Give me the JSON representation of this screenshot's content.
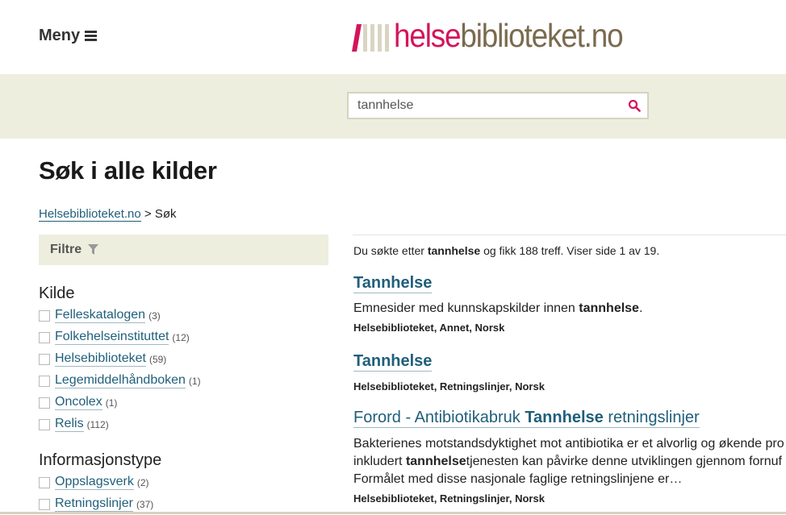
{
  "header": {
    "menu_label": "Meny",
    "logo_part1": "helse",
    "logo_part2": "biblioteket.no",
    "colors": {
      "pink": "#d4145a",
      "brown": "#7a6a4e",
      "beige": "#eeeedf",
      "link": "#1f5f7a"
    }
  },
  "search": {
    "value": "tannhelse",
    "icon": "search-icon"
  },
  "page": {
    "title": "Søk i alle kilder"
  },
  "breadcrumb": {
    "home": "Helsebiblioteket.no",
    "separator": ">",
    "current": "Søk"
  },
  "filters": {
    "label": "Filtre",
    "icon": "filter-icon",
    "groups": [
      {
        "title": "Kilde",
        "items": [
          {
            "label": "Felleskatalogen",
            "count": "(3)"
          },
          {
            "label": "Folkehelseinstituttet",
            "count": "(12)"
          },
          {
            "label": "Helsebiblioteket",
            "count": "(59)"
          },
          {
            "label": "Legemiddelhåndboken",
            "count": "(1)"
          },
          {
            "label": "Oncolex",
            "count": "(1)"
          },
          {
            "label": "Relis",
            "count": "(112)"
          }
        ]
      },
      {
        "title": "Informasjonstype",
        "items": [
          {
            "label": "Oppslagsverk",
            "count": "(2)"
          },
          {
            "label": "Retningslinjer",
            "count": "(37)"
          }
        ]
      }
    ]
  },
  "summary": {
    "prefix": "Du søkte etter",
    "term": "tannhelse",
    "suffix": "og fikk 188 treff. Viser side 1 av 19."
  },
  "results": [
    {
      "title": "Tannhelse",
      "desc_pre": "Emnesider med kunnskapskilder innen",
      "desc_bold": "tannhelse",
      "desc_post": ".",
      "meta": "Helsebiblioteket, Annet, Norsk"
    },
    {
      "title": "Tannhelse",
      "meta": "Helsebiblioteket, Retningslinjer, Norsk"
    },
    {
      "title_pre": "Forord - Antibiotikabruk",
      "title_bold": "Tannhelse",
      "title_post": "retningslinjer",
      "line1": "Bakterienes motstandsdyktighet mot antibiotika er et alvorlig og økende pro",
      "line2_pre": "inkludert",
      "line2_bold": "tannhelse",
      "line2_post": "tjenesten kan påvirke denne utviklingen gjennom fornuf",
      "line3": "Formålet med disse nasjonale faglige retningslinjene er…",
      "meta": "Helsebiblioteket, Retningslinjer, Norsk"
    }
  ]
}
